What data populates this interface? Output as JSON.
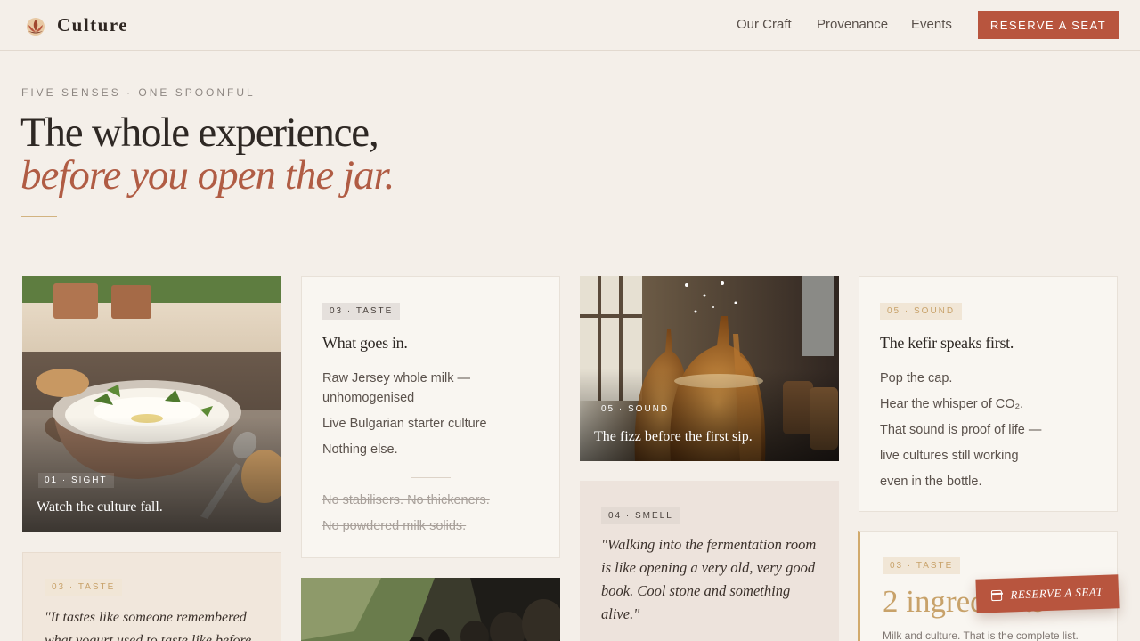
{
  "nav": {
    "brand": "Culture",
    "links": [
      "Our Craft",
      "Provenance",
      "Events"
    ],
    "cta": "RESERVE A SEAT"
  },
  "hero": {
    "eyebrow": "FIVE SENSES · ONE SPOONFUL",
    "title_line1": "The whole experience,",
    "title_line2": "before you open the jar."
  },
  "cards": {
    "sight": {
      "badge": "01 · SIGHT",
      "caption": "Watch the culture fall."
    },
    "taste_list": {
      "badge": "03 · TASTE",
      "title": "What goes in.",
      "items": [
        "Raw Jersey whole milk —",
        "unhomogenised",
        "Live Bulgarian starter culture",
        "Nothing else."
      ],
      "struck": [
        "No stabilisers. No thickeners.",
        "No powdered milk solids."
      ]
    },
    "sound_image": {
      "badge": "05 · SOUND",
      "caption": "The fizz before the first sip."
    },
    "sound_text": {
      "badge": "05 · SOUND",
      "title": "The kefir speaks first.",
      "lines": [
        "Pop the cap.",
        "Hear the whisper of CO₂.",
        "That sound is proof of life —",
        "live cultures still working",
        "even in the bottle."
      ]
    },
    "taste_quote": {
      "badge": "03 · TASTE",
      "quote": "\"It tastes like someone remembered what yogurt used to taste like before"
    },
    "smell": {
      "badge": "04 · SMELL",
      "quote": "\"Walking into the fermentation room is like opening a very old, very good book. Cool stone and something alive.\""
    },
    "taste_count": {
      "badge": "03 · TASTE",
      "headline": "2 ingredients",
      "sub": "Milk and culture. That is the complete list."
    }
  },
  "floating_cta": "RESERVE A SEAT",
  "colors": {
    "accent": "#b8553e",
    "gold": "#c8a26a",
    "background": "#f4efe9"
  }
}
